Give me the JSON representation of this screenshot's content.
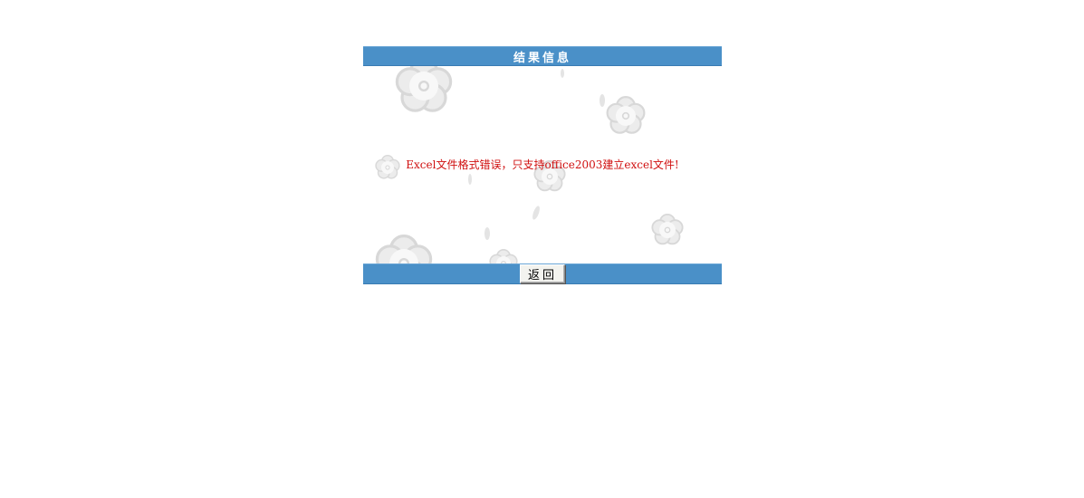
{
  "header": {
    "title": "结果信息"
  },
  "message": {
    "text": "Excel文件格式错误，只支持office2003建立excel文件!",
    "color": "#d01010"
  },
  "footer": {
    "back_label": "返回"
  },
  "colors": {
    "bar": "#4a90c8",
    "decor": "#dcdcdc"
  },
  "icons": [
    "flower-icon"
  ]
}
